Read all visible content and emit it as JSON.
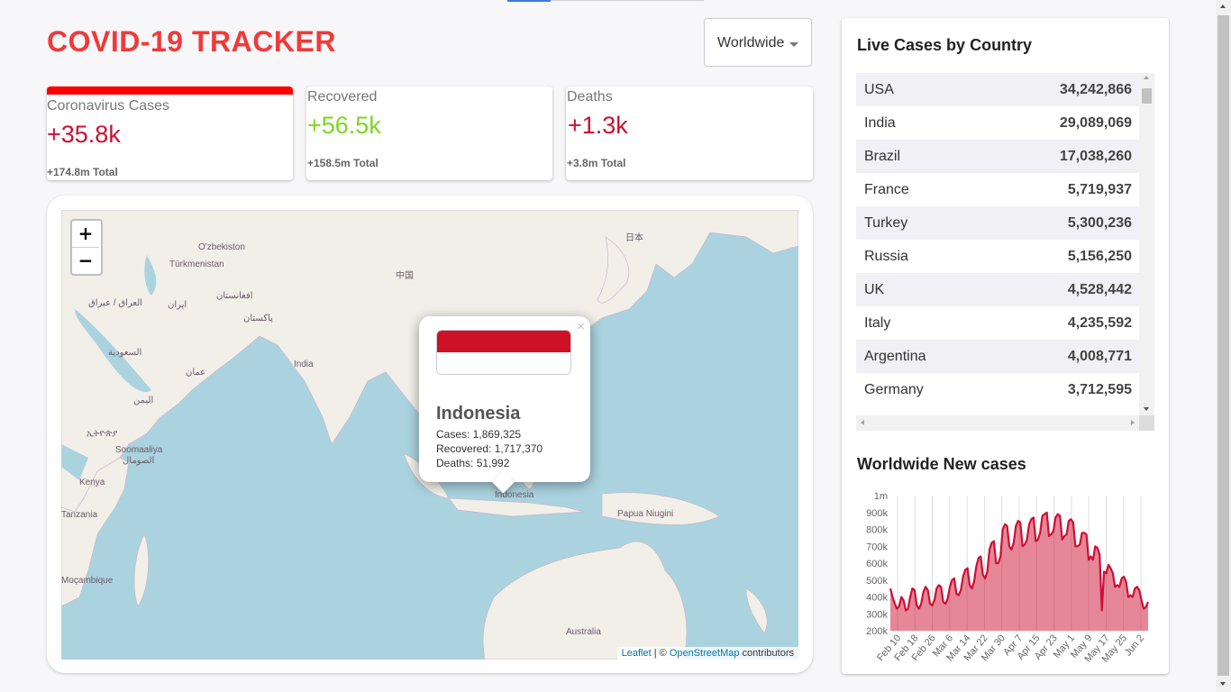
{
  "header": {
    "title": "COVID-19 TRACKER"
  },
  "country_select": {
    "value": "Worldwide"
  },
  "info_cards": [
    {
      "label": "Coronavirus Cases",
      "today": "+35.8k",
      "total": "+174.8m Total",
      "color": "#cc1034",
      "selected": true
    },
    {
      "label": "Recovered",
      "today": "+56.5k",
      "total": "+158.5m Total",
      "color": "#7dd71d",
      "selected": false
    },
    {
      "label": "Deaths",
      "today": "+1.3k",
      "total": "+3.8m Total",
      "color": "#cc1034",
      "selected": false
    }
  ],
  "map": {
    "zoom_in": "+",
    "zoom_out": "−",
    "labels": [
      "O'zbekiston",
      "Türkmenistan",
      "افغانستان",
      "العراق / عيراق",
      "ایران",
      "پاکستان",
      "中国",
      "日本",
      "India",
      "السعودية",
      "عمان",
      "اليمن",
      "ኢትዮጵያ",
      "Soomaaliya",
      "الصومال",
      "Kenya",
      "Tanzania",
      "Moçambique",
      "Indonesia",
      "Papua Niugini",
      "Australia"
    ],
    "popup": {
      "close": "×",
      "country": "Indonesia",
      "cases": "Cases: 1,869,325",
      "recovered": "Recovered: 1,717,370",
      "deaths": "Deaths: 51,992",
      "flag_colors": [
        "#ce1126",
        "#ffffff"
      ]
    },
    "attribution": {
      "leaflet": "Leaflet",
      "sep": " | © ",
      "osm": "OpenStreetMap",
      "suffix": " contributors"
    }
  },
  "sidebar": {
    "table_title": "Live Cases by Country",
    "rows": [
      {
        "country": "USA",
        "cases": "34,242,866"
      },
      {
        "country": "India",
        "cases": "29,089,069"
      },
      {
        "country": "Brazil",
        "cases": "17,038,260"
      },
      {
        "country": "France",
        "cases": "5,719,937"
      },
      {
        "country": "Turkey",
        "cases": "5,300,236"
      },
      {
        "country": "Russia",
        "cases": "5,156,250"
      },
      {
        "country": "UK",
        "cases": "4,528,442"
      },
      {
        "country": "Italy",
        "cases": "4,235,592"
      },
      {
        "country": "Argentina",
        "cases": "4,008,771"
      },
      {
        "country": "Germany",
        "cases": "3,712,595"
      }
    ],
    "chart_title": "Worldwide New cases"
  },
  "chart_data": {
    "type": "area",
    "title": "Worldwide New cases",
    "ylim": [
      200000,
      1000000
    ],
    "yticks": [
      "200k",
      "300k",
      "400k",
      "500k",
      "600k",
      "700k",
      "800k",
      "900k",
      "1m"
    ],
    "xticks": [
      "Feb 10",
      "Feb 18",
      "Feb 26",
      "Mar 6",
      "Mar 14",
      "Mar 22",
      "Mar 30",
      "Apr 7",
      "Apr 15",
      "Apr 23",
      "May 1",
      "May 9",
      "May 17",
      "May 25",
      "Jun 2"
    ],
    "grid": "vertical",
    "color": "#cc1034",
    "fill": "rgba(204,16,52,0.5)",
    "x_start": "2021-02-08",
    "x_end": "2021-06-07",
    "values": [
      450000,
      400000,
      360000,
      330000,
      345000,
      400000,
      380000,
      320000,
      330000,
      400000,
      450000,
      440000,
      350000,
      330000,
      360000,
      430000,
      460000,
      440000,
      360000,
      350000,
      380000,
      450000,
      470000,
      460000,
      370000,
      360000,
      390000,
      460000,
      500000,
      510000,
      420000,
      410000,
      440000,
      520000,
      560000,
      570000,
      470000,
      450000,
      490000,
      580000,
      630000,
      640000,
      530000,
      510000,
      550000,
      680000,
      720000,
      730000,
      600000,
      600000,
      640000,
      800000,
      830000,
      820000,
      700000,
      680000,
      720000,
      820000,
      850000,
      840000,
      700000,
      710000,
      740000,
      830000,
      860000,
      870000,
      730000,
      740000,
      780000,
      880000,
      890000,
      900000,
      760000,
      770000,
      790000,
      870000,
      890000,
      880000,
      740000,
      760000,
      770000,
      850000,
      860000,
      840000,
      700000,
      700000,
      710000,
      780000,
      780000,
      770000,
      620000,
      640000,
      620000,
      700000,
      690000,
      650000,
      320000,
      550000,
      540000,
      590000,
      570000,
      540000,
      460000,
      470000,
      460000,
      510000,
      520000,
      490000,
      400000,
      410000,
      400000,
      450000,
      460000,
      440000,
      380000,
      330000,
      340000,
      370000
    ]
  }
}
